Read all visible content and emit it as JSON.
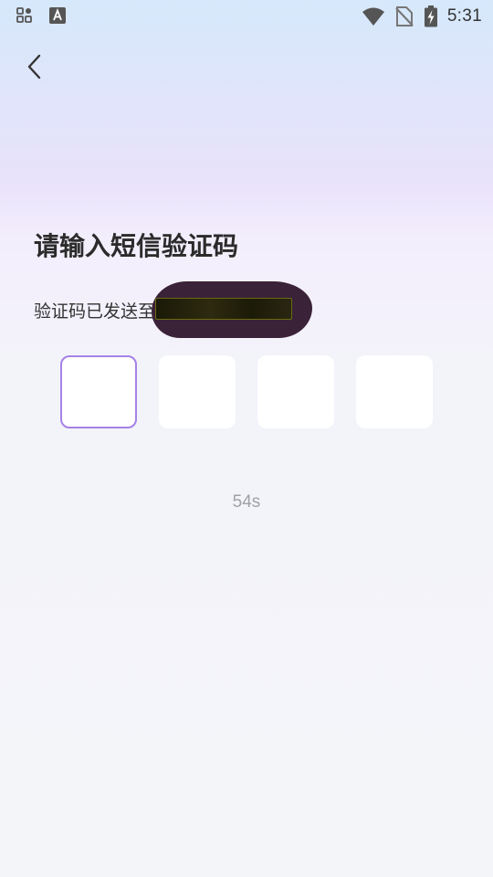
{
  "status_bar": {
    "time": "5:31",
    "left_icons": [
      "apps-grid-icon",
      "font-a-icon"
    ],
    "right_icons": [
      "wifi-icon",
      "no-sim-icon",
      "battery-charging-icon"
    ]
  },
  "nav": {
    "back_icon": "chevron-left-icon"
  },
  "main": {
    "title": "请输入短信验证码",
    "subtitle": "验证码已发送至",
    "code_boxes": [
      "",
      "",
      "",
      ""
    ],
    "active_box": 0,
    "countdown": "54s"
  },
  "colors": {
    "accent": "#a682e6",
    "title": "#2b2b2b",
    "countdown": "#a0a0a6",
    "box_bg": "#ffffff"
  }
}
